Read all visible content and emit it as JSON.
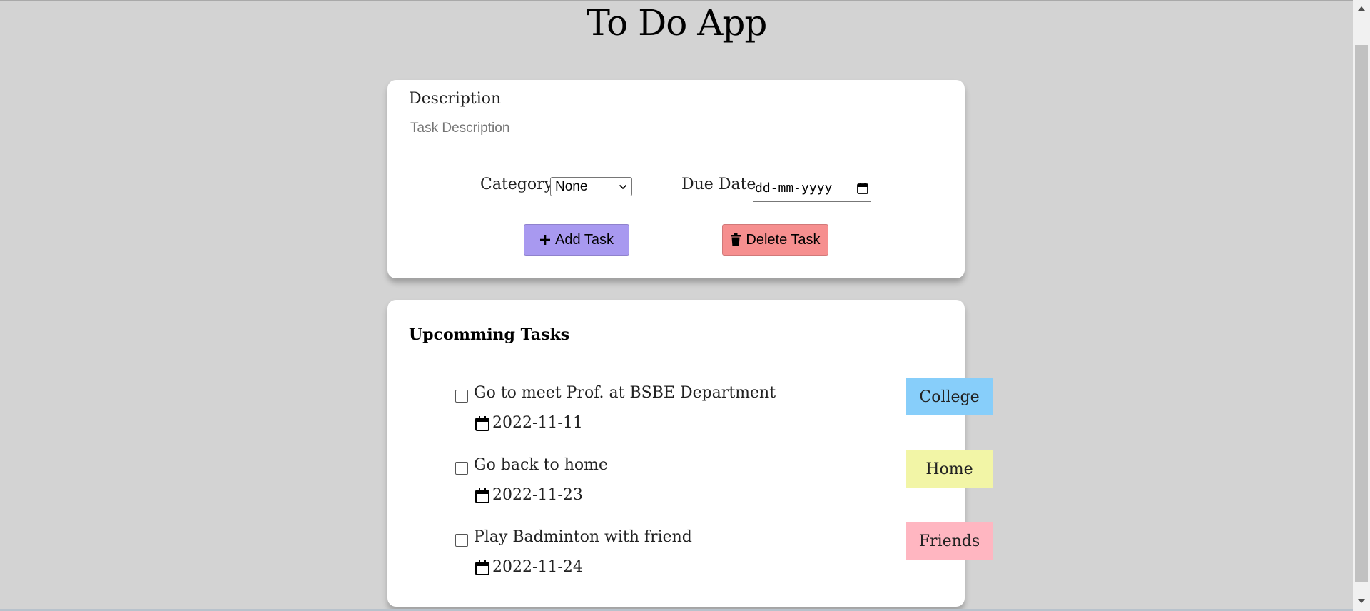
{
  "app": {
    "title": "To Do App"
  },
  "form": {
    "description_label": "Description",
    "description_placeholder": "Task Description",
    "description_value": "",
    "category_label": "Category",
    "category_selected": "None",
    "due_date_label": "Due Date",
    "due_date_placeholder": "dd-mm-yyyy",
    "add_button_label": "Add Task",
    "delete_button_label": "Delete Task",
    "add_button_color": "#a899f0",
    "delete_button_color": "#f68f8f",
    "icons": {
      "add": "plus-icon",
      "delete": "trash-icon",
      "calendar": "calendar-icon",
      "dropdown": "chevron-down-icon"
    }
  },
  "tasks": {
    "title": "Upcomming Tasks",
    "items": [
      {
        "text": "Go to meet Prof. at BSBE Department",
        "date": "2022-11-11",
        "category": "College",
        "category_color": "#87cefa",
        "checked": false
      },
      {
        "text": "Go back to home",
        "date": "2022-11-23",
        "category": "Home",
        "category_color": "#f2f5a6",
        "checked": false
      },
      {
        "text": "Play Badminton with friend",
        "date": "2022-11-24",
        "category": "Friends",
        "category_color": "#ffb6c1",
        "checked": false
      }
    ]
  },
  "colors": {
    "page_background": "#d3d3d3",
    "card_background": "#ffffff"
  }
}
